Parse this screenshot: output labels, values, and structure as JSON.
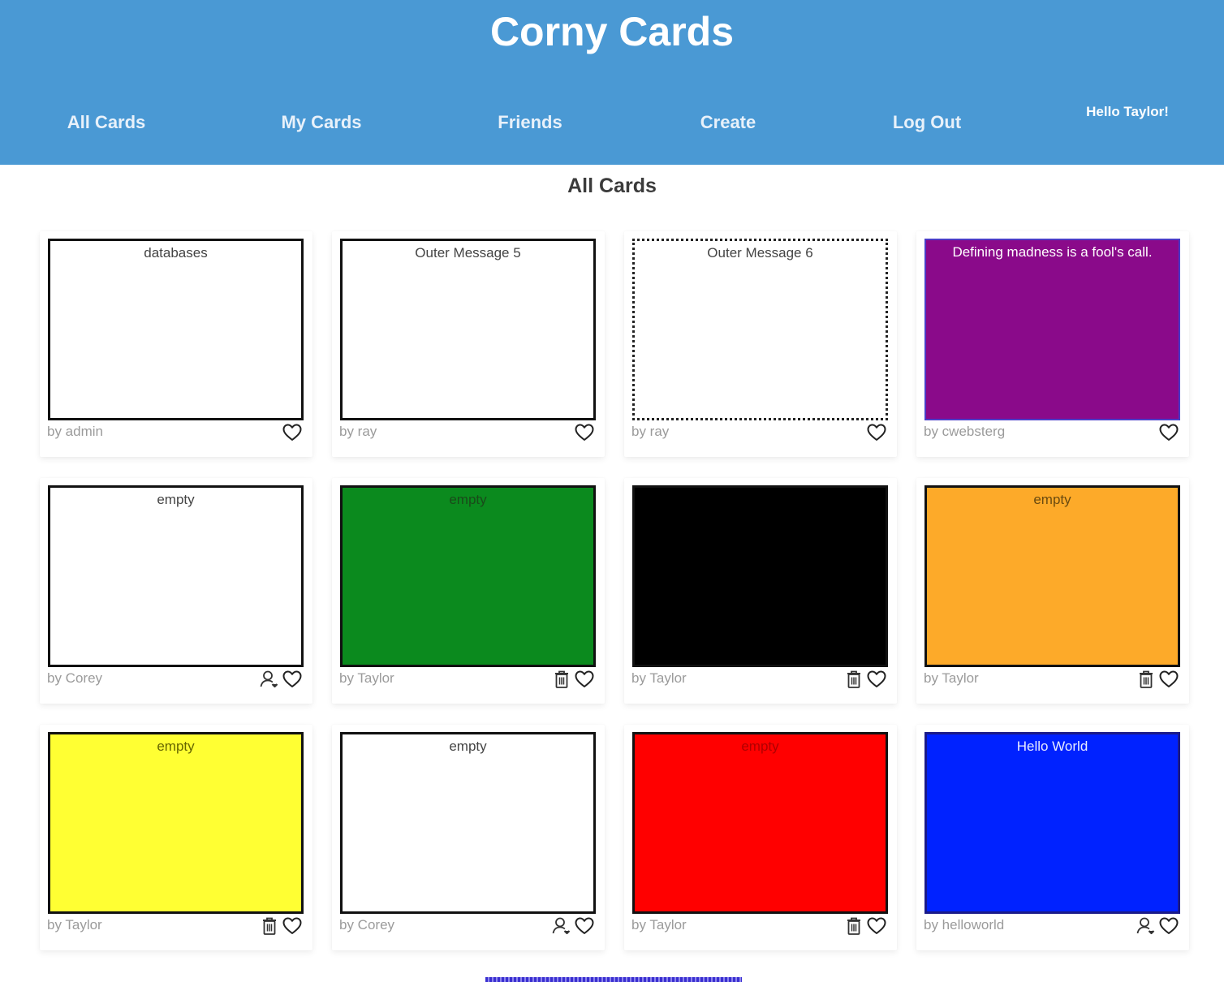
{
  "app": {
    "title": "Corny Cards",
    "brand_color": "#4a99d4"
  },
  "nav": {
    "items": [
      {
        "label": "All Cards"
      },
      {
        "label": "My Cards"
      },
      {
        "label": "Friends"
      },
      {
        "label": "Create"
      },
      {
        "label": "Log Out"
      }
    ],
    "greeting": "Hello Taylor!"
  },
  "page": {
    "heading": "All Cards"
  },
  "cards": [
    {
      "message": "databases",
      "author": "by admin",
      "bg": "#ffffff",
      "text_color": "#444444",
      "border": "solid",
      "actions": [
        "heart-icon"
      ]
    },
    {
      "message": "Outer Message 5",
      "author": "by ray",
      "bg": "#ffffff",
      "text_color": "#444444",
      "border": "solid",
      "actions": [
        "heart-icon"
      ]
    },
    {
      "message": "Outer Message 6",
      "author": "by ray",
      "bg": "#ffffff",
      "text_color": "#444444",
      "border": "dotted",
      "actions": [
        "heart-icon"
      ]
    },
    {
      "message": "Defining madness is a fool's call.",
      "author": "by cwebsterg",
      "bg": "#8a0a8a",
      "text_color": "#ffffff",
      "border": "violet",
      "actions": [
        "heart-icon"
      ]
    },
    {
      "message": "empty",
      "author": "by Corey",
      "bg": "#ffffff",
      "text_color": "#444444",
      "border": "solid",
      "actions": [
        "add-friend-icon",
        "heart-icon"
      ]
    },
    {
      "message": "empty",
      "author": "by Taylor",
      "bg": "#0b8a1e",
      "text_color": "#1a4a1a",
      "border": "solid",
      "actions": [
        "trash-icon",
        "heart-icon"
      ]
    },
    {
      "message": "",
      "author": "by Taylor",
      "bg": "#000000",
      "text_color": "#000000",
      "border": "solid",
      "actions": [
        "trash-icon",
        "heart-icon"
      ]
    },
    {
      "message": "empty",
      "author": "by Taylor",
      "bg": "#fdaa29",
      "text_color": "#6a4a10",
      "border": "solid",
      "actions": [
        "trash-icon",
        "heart-icon"
      ]
    },
    {
      "message": "empty",
      "author": "by Taylor",
      "bg": "#ffff33",
      "text_color": "#666600",
      "border": "solid",
      "actions": [
        "trash-icon",
        "heart-icon"
      ]
    },
    {
      "message": "empty",
      "author": "by Corey",
      "bg": "#ffffff",
      "text_color": "#444444",
      "border": "solid",
      "actions": [
        "add-friend-icon",
        "heart-icon"
      ]
    },
    {
      "message": "empty",
      "author": "by Taylor",
      "bg": "#ff0000",
      "text_color": "#b00000",
      "border": "solid",
      "actions": [
        "trash-icon",
        "heart-icon"
      ]
    },
    {
      "message": "Hello World",
      "author": "by helloworld",
      "bg": "#0022ff",
      "text_color": "#e8ecff",
      "border": "blue",
      "actions": [
        "add-friend-icon",
        "heart-icon"
      ]
    }
  ]
}
